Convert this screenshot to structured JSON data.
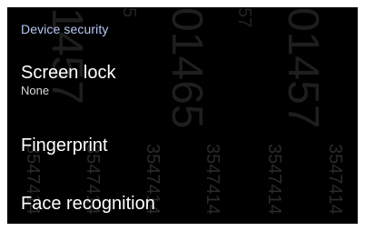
{
  "section": {
    "title": "Device security"
  },
  "items": [
    {
      "title": "Screen lock",
      "summary": "None"
    },
    {
      "title": "Fingerprint"
    },
    {
      "title": "Face recognition"
    }
  ],
  "colors": {
    "background": "#000000",
    "header": "#b9c8f5",
    "title": "#ffffff",
    "summary": "#d9d9d9"
  }
}
